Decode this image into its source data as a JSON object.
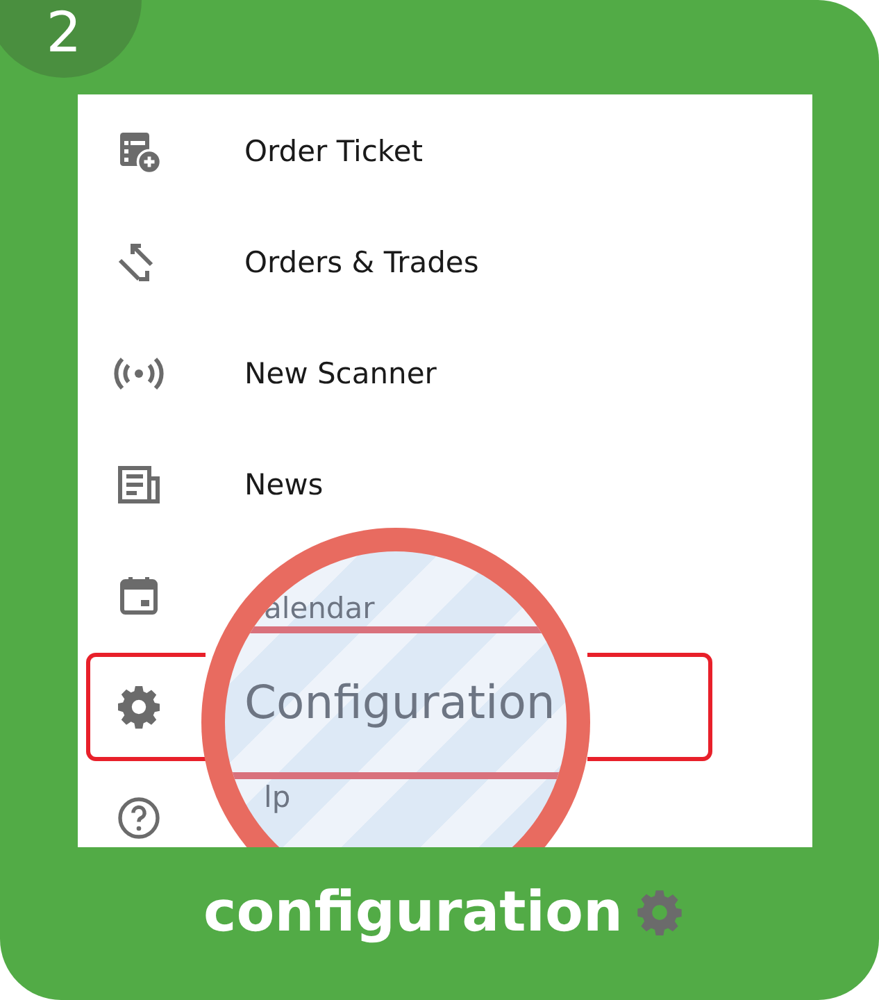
{
  "step_badge": "2",
  "menu": {
    "items": [
      {
        "kind": "ticket",
        "label": "Order Ticket",
        "highlighted": false
      },
      {
        "kind": "arrows",
        "label": "Orders & Trades",
        "highlighted": false
      },
      {
        "kind": "broadcast",
        "label": "New Scanner",
        "highlighted": false
      },
      {
        "kind": "news",
        "label": "News",
        "highlighted": false
      },
      {
        "kind": "calendar",
        "highlighted": false
      },
      {
        "kind": "gear",
        "highlighted": true
      },
      {
        "kind": "help",
        "highlighted": false
      }
    ]
  },
  "magnifier": {
    "lines": [
      {
        "text": "alendar",
        "highlighted": false
      },
      {
        "text": "Configuration",
        "highlighted": true
      },
      {
        "text": "lp",
        "highlighted": false
      }
    ]
  },
  "caption": {
    "text": "configuration"
  }
}
